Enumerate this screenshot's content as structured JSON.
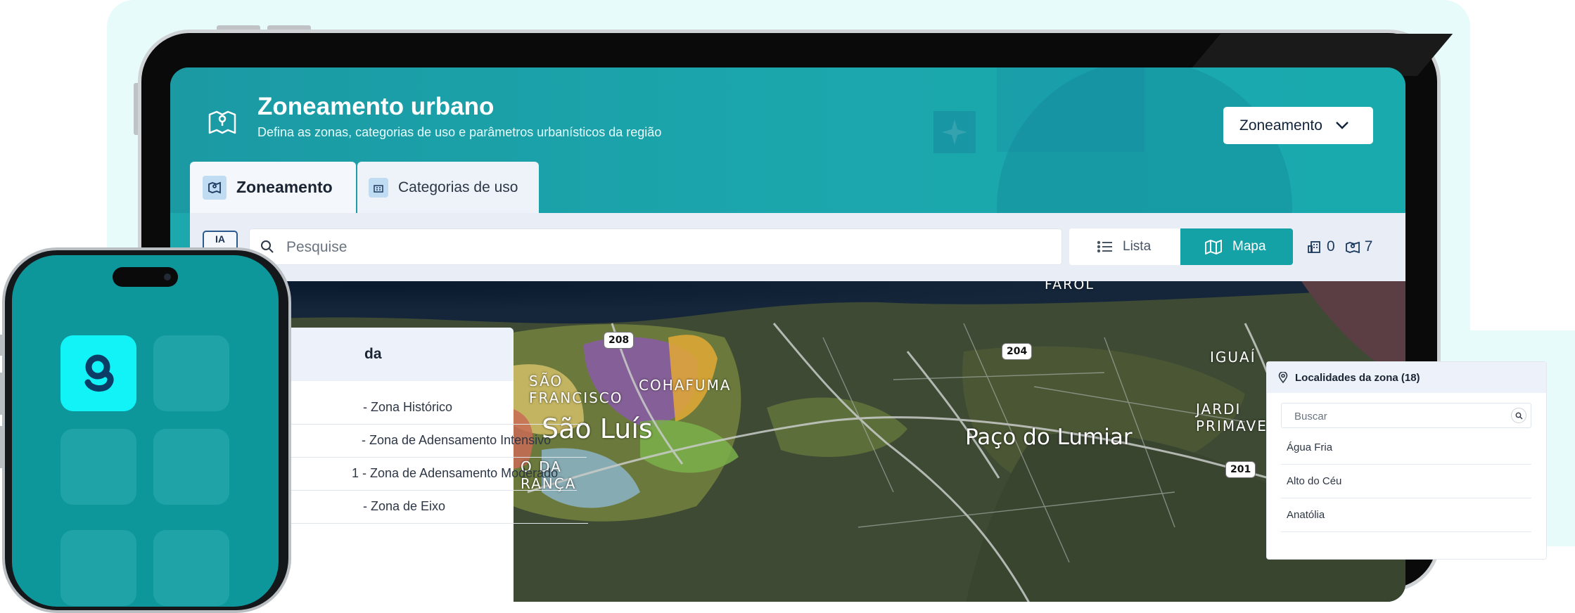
{
  "header": {
    "title": "Zoneamento urbano",
    "subtitle": "Defina as zonas, categorias de uso e parâmetros urbanísticos da região",
    "dropdown_label": "Zoneamento"
  },
  "tabs": [
    {
      "label": "Zoneamento",
      "active": true
    },
    {
      "label": "Categorias de uso",
      "active": false
    }
  ],
  "toolbar": {
    "ia_label": "IA",
    "search_placeholder": "Pesquise",
    "list_label": "Lista",
    "map_label": "Mapa",
    "count_a": "0",
    "count_b": "7"
  },
  "legend": {
    "title_fragment": "da",
    "items": [
      "- Zona Histórico",
      "- Zona de Adensamento Intensivo",
      "1 - Zona de Adensamento Moderado",
      "- Zona de Eixo"
    ]
  },
  "map": {
    "labels": {
      "farol": "FAROL",
      "sao_francisco": "SÃO\nFRANCISCO",
      "cohafuma": "COHAFUMA",
      "sao_luis": "São Luís",
      "paco": "Paço do Lumiar",
      "iguaiba": "IGUAÍ",
      "jardim": "JARDI\nPRIMAVE",
      "ponta_da_franca": "O DA\nRANÇA"
    },
    "shields": [
      "208",
      "204",
      "201"
    ]
  },
  "card": {
    "title": "Localidades da zona (18)",
    "search_placeholder": "Buscar",
    "items": [
      "Água Fria",
      "Alto do Céu",
      "Anatólia"
    ]
  },
  "colors": {
    "brand_teal": "#15a2a7",
    "header_teal": "#1ba7ad",
    "bg_mint": "#e7fbfb",
    "app_icon": "#12f3f7"
  },
  "icons": {
    "header": "map-pin-icon",
    "search": "search-icon",
    "list": "list-icon",
    "map": "map-icon",
    "chevron": "chevron-down-icon",
    "location": "location-pin-icon",
    "app_logo": "g-logo-icon"
  }
}
